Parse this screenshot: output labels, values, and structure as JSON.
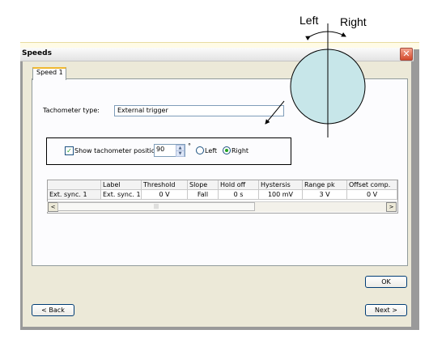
{
  "window": {
    "title": "Speeds",
    "close_icon": "close-icon",
    "close_glyph": "✕"
  },
  "tabs": [
    {
      "label": "Speed 1",
      "selected": true
    }
  ],
  "tachometer": {
    "type_label": "Tachometer type:",
    "type_value": "External trigger",
    "show_position_label": "Show tachometer position:",
    "show_position_checked": true,
    "position_value": "90",
    "degree_symbol": "°",
    "direction_options": [
      "Left",
      "Right"
    ],
    "direction_selected": "Right"
  },
  "grid": {
    "columns": [
      "",
      "Label",
      "Threshold",
      "Slope",
      "Hold off",
      "Hystersis",
      "Range pk",
      "Offset comp."
    ],
    "rows": [
      [
        "Ext. sync. 1",
        "Ext. sync. 1",
        "0 V",
        "Fall",
        "0 s",
        "100 mV",
        "3 V",
        "0 V"
      ]
    ]
  },
  "scrollbar": {
    "left_glyph": "<",
    "right_glyph": ">",
    "thumb_glyph": "|||"
  },
  "buttons": {
    "ok": "OK",
    "back": "< Back",
    "next": "Next >"
  },
  "annotation": {
    "left_label": "Left",
    "right_label": "Right",
    "circle_fill": "#c7e6e9"
  },
  "colors": {
    "accent_green": "#21a121",
    "tab_highlight": "#f0b830",
    "close_red": "#d3492b"
  }
}
